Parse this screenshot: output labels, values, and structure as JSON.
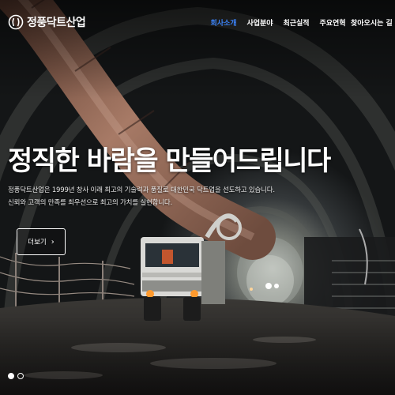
{
  "brand": {
    "name": "정풍닥트산업"
  },
  "nav": {
    "items": [
      {
        "label": "회사소개",
        "active": true
      },
      {
        "label": "사업분야",
        "active": false
      },
      {
        "label": "최근실적",
        "active": false
      },
      {
        "label": "주요연혁",
        "active": false
      },
      {
        "label": "찾아오시는 길",
        "active": false
      }
    ]
  },
  "hero": {
    "title": "정직한 바람을 만들어드립니다",
    "desc_line1": "정풍닥트산업은 1999년 창사 이래 최고의 기술력과 품질로 대한민국 닥트업을 선도하고 있습니다.",
    "desc_line2": "신뢰와 고객의 만족를 최우선으로 최고의 가치를 실현합니다.",
    "button_label": "더보기",
    "button_icon": "chevron-right-icon"
  },
  "slider": {
    "slides": 2,
    "active_index": 0
  },
  "colors": {
    "accent": "#3b82f6",
    "text": "#ffffff"
  }
}
